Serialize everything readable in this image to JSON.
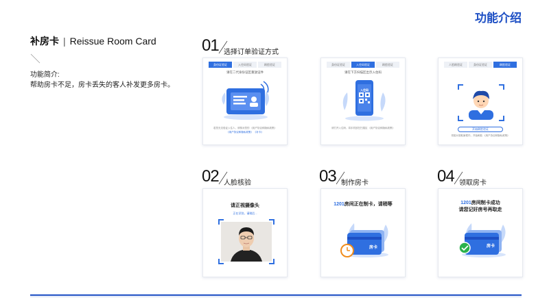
{
  "header": {
    "section_title": "功能介绍"
  },
  "feature": {
    "title_cn": "补房卡",
    "separator": "|",
    "title_en": "Reissue Room Card",
    "intro_label": "功能简介:",
    "intro_text": "帮助房卡不足，房卡丢失的客人补发更多房卡。"
  },
  "steps": [
    {
      "num": "01",
      "label": "选择订单验证方式"
    },
    {
      "num": "02",
      "label": "人脸核验"
    },
    {
      "num": "03",
      "label": "制作房卡"
    },
    {
      "num": "04",
      "label": "领取房卡"
    }
  ],
  "verify_tabs": [
    "身份证验证",
    "人脸刷验证",
    "刷脸验证"
  ],
  "screens": {
    "id_card": {
      "tabs": [
        "身份证验证",
        "入住码验证",
        "刷脸验证"
      ],
      "active_tab": 0,
      "hint": "请在二代身份证区重放证件",
      "fine_print": "若您无法验证入住人，请核对您的 《用户协议和隐私政策》",
      "links": "《用户协议和隐私政策》  《补卡》"
    },
    "qr": {
      "tabs": [
        "身份证验证",
        "入住码验证",
        "刷脸验证"
      ],
      "active_tab": 1,
      "hint": "请在下方扫描区出示入住码",
      "phone_label": "入住码",
      "fine_print": "请打开入住码，将手机放在扫描区 《用户协议和隐私政策》"
    },
    "face": {
      "tabs": [
        "人脸刷验证",
        "身份证验证",
        "刷脸验证"
      ],
      "active_tab": 2,
      "button": "开始刷脸验证",
      "fine_print": "将脸对准取景框内，开始刷脸 《用户协议和隐私政策》"
    },
    "face_check": {
      "title": "请正视摄像头",
      "subtitle": "正在识别，请稍后..."
    },
    "make_card": {
      "room": "1201",
      "msg_line1": "房间正在制卡，请稍等",
      "card_label": "房卡"
    },
    "take_card": {
      "room": "1201",
      "msg_line1": "房间制卡成功",
      "msg_line2": "请您记好房号再取走",
      "card_label": "房卡"
    }
  },
  "colors": {
    "accent": "#2f6fe0",
    "title_blue": "#1d4fc4"
  }
}
